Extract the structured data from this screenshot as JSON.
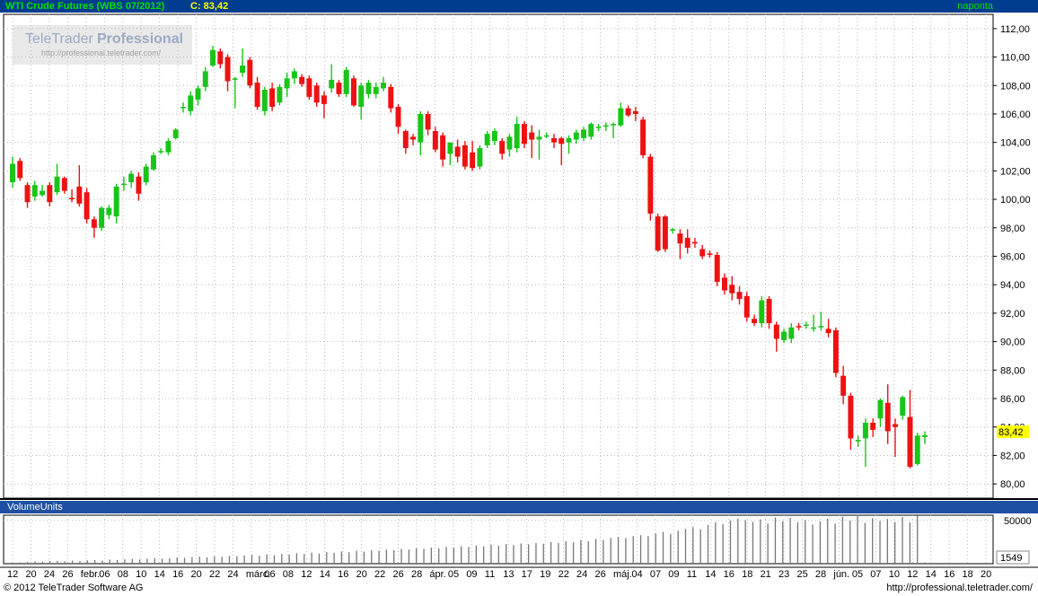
{
  "header": {
    "title": "WTI Crude Futures (WBS 07/2012)",
    "last": "C: 83,42",
    "interval": "naponta"
  },
  "volume_panel": {
    "title": "VolumeUnits",
    "last": "1549"
  },
  "watermark": {
    "brand": "TeleTrader",
    "product": "Professional",
    "url": "http://professional.teletrader.com/"
  },
  "footer": {
    "copyright": "© 2012 TeleTrader Software AG",
    "url": "http://professional.teletrader.com/"
  },
  "colors": {
    "up": "#19c419",
    "down": "#ee1111",
    "grid": "#b8b8b8",
    "header_bg": "#003d8f",
    "last_badge": "#ffff00"
  },
  "chart_data": [
    {
      "type": "candlestick",
      "title": "WTI Crude Futures (WBS 07/2012)",
      "last_price_label": "83,42",
      "ylim": [
        79,
        113
      ],
      "yticks": [
        "80,00",
        "82,00",
        "84,00",
        "86,00",
        "88,00",
        "90,00",
        "92,00",
        "94,00",
        "96,00",
        "98,00",
        "100,00",
        "102,00",
        "104,00",
        "106,00",
        "108,00",
        "110,00",
        "112,00"
      ],
      "xtick_labels": [
        "12",
        "20",
        "24",
        "26",
        "febr.",
        "06",
        "08",
        "10",
        "14",
        "16",
        "20",
        "22",
        "24",
        "márc.",
        "06",
        "08",
        "12",
        "14",
        "16",
        "20",
        "22",
        "26",
        "28",
        "ápr.",
        "05",
        "09",
        "11",
        "13",
        "17",
        "19",
        "22",
        "24",
        "26",
        "máj.",
        "04",
        "07",
        "09",
        "11",
        "14",
        "16",
        "18",
        "21",
        "23",
        "25",
        "28",
        "jún.",
        "05",
        "07",
        "10",
        "12",
        "14",
        "16",
        "18",
        "20"
      ],
      "candles": [
        {
          "o": 101.2,
          "h": 103.0,
          "l": 100.8,
          "c": 102.5
        },
        {
          "o": 102.7,
          "h": 102.9,
          "l": 101.3,
          "c": 101.5
        },
        {
          "o": 101.0,
          "h": 101.2,
          "l": 99.4,
          "c": 99.8
        },
        {
          "o": 100.2,
          "h": 101.3,
          "l": 99.9,
          "c": 101.0
        },
        {
          "o": 100.3,
          "h": 101.0,
          "l": 100.2,
          "c": 100.6
        },
        {
          "o": 101.0,
          "h": 101.2,
          "l": 99.5,
          "c": 99.8
        },
        {
          "o": 100.5,
          "h": 102.5,
          "l": 100.3,
          "c": 101.6
        },
        {
          "o": 101.5,
          "h": 101.6,
          "l": 100.4,
          "c": 100.6
        },
        {
          "o": 100.1,
          "h": 100.7,
          "l": 99.8,
          "c": 100.0
        },
        {
          "o": 100.9,
          "h": 102.4,
          "l": 99.5,
          "c": 99.7
        },
        {
          "o": 100.5,
          "h": 100.8,
          "l": 98.3,
          "c": 98.6
        },
        {
          "o": 98.6,
          "h": 98.8,
          "l": 97.3,
          "c": 98.0
        },
        {
          "o": 98.0,
          "h": 99.5,
          "l": 97.8,
          "c": 99.4
        },
        {
          "o": 98.9,
          "h": 99.6,
          "l": 98.6,
          "c": 99.4
        },
        {
          "o": 98.8,
          "h": 101.1,
          "l": 98.3,
          "c": 100.9
        },
        {
          "o": 101.0,
          "h": 101.6,
          "l": 100.6,
          "c": 101.1
        },
        {
          "o": 101.2,
          "h": 102.0,
          "l": 100.8,
          "c": 101.8
        },
        {
          "o": 101.6,
          "h": 101.9,
          "l": 99.9,
          "c": 100.4
        },
        {
          "o": 101.2,
          "h": 102.5,
          "l": 101.0,
          "c": 102.3
        },
        {
          "o": 102.1,
          "h": 103.3,
          "l": 102.0,
          "c": 103.1
        },
        {
          "o": 103.4,
          "h": 103.6,
          "l": 103.2,
          "c": 103.4
        },
        {
          "o": 103.3,
          "h": 104.3,
          "l": 103.1,
          "c": 104.1
        },
        {
          "o": 104.3,
          "h": 105.0,
          "l": 104.2,
          "c": 104.9
        },
        {
          "o": 106.5,
          "h": 106.8,
          "l": 106.1,
          "c": 106.5
        },
        {
          "o": 106.2,
          "h": 107.6,
          "l": 105.9,
          "c": 107.3
        },
        {
          "o": 107.0,
          "h": 108.0,
          "l": 106.6,
          "c": 107.8
        },
        {
          "o": 107.9,
          "h": 109.3,
          "l": 107.6,
          "c": 109.0
        },
        {
          "o": 109.4,
          "h": 110.8,
          "l": 109.3,
          "c": 110.5
        },
        {
          "o": 110.4,
          "h": 110.6,
          "l": 109.2,
          "c": 109.5
        },
        {
          "o": 110.0,
          "h": 110.2,
          "l": 107.6,
          "c": 108.3
        },
        {
          "o": 108.5,
          "h": 108.6,
          "l": 106.4,
          "c": 108.5
        },
        {
          "o": 108.9,
          "h": 110.6,
          "l": 108.6,
          "c": 109.4
        },
        {
          "o": 109.8,
          "h": 110.0,
          "l": 107.8,
          "c": 108.0
        },
        {
          "o": 108.2,
          "h": 108.6,
          "l": 106.3,
          "c": 106.5
        },
        {
          "o": 106.2,
          "h": 107.9,
          "l": 105.9,
          "c": 107.7
        },
        {
          "o": 107.8,
          "h": 108.2,
          "l": 106.2,
          "c": 106.5
        },
        {
          "o": 106.8,
          "h": 108.1,
          "l": 106.6,
          "c": 107.9
        },
        {
          "o": 107.8,
          "h": 108.9,
          "l": 107.2,
          "c": 108.5
        },
        {
          "o": 108.5,
          "h": 109.2,
          "l": 108.1,
          "c": 109.0
        },
        {
          "o": 108.6,
          "h": 108.8,
          "l": 107.9,
          "c": 108.1
        },
        {
          "o": 108.5,
          "h": 108.7,
          "l": 107.0,
          "c": 107.2
        },
        {
          "o": 108.0,
          "h": 108.2,
          "l": 106.5,
          "c": 106.8
        },
        {
          "o": 107.3,
          "h": 107.6,
          "l": 105.7,
          "c": 106.7
        },
        {
          "o": 107.8,
          "h": 109.5,
          "l": 107.5,
          "c": 108.4
        },
        {
          "o": 108.2,
          "h": 108.4,
          "l": 107.2,
          "c": 107.4
        },
        {
          "o": 107.4,
          "h": 109.3,
          "l": 107.2,
          "c": 109.1
        },
        {
          "o": 108.5,
          "h": 108.7,
          "l": 106.5,
          "c": 106.6
        },
        {
          "o": 106.5,
          "h": 108.2,
          "l": 105.6,
          "c": 108.0
        },
        {
          "o": 107.4,
          "h": 108.4,
          "l": 107.1,
          "c": 108.2
        },
        {
          "o": 107.4,
          "h": 108.2,
          "l": 107.1,
          "c": 107.9
        },
        {
          "o": 107.8,
          "h": 108.6,
          "l": 107.6,
          "c": 108.2
        },
        {
          "o": 107.9,
          "h": 108.1,
          "l": 106.1,
          "c": 106.4
        },
        {
          "o": 106.5,
          "h": 106.7,
          "l": 104.6,
          "c": 105.1
        },
        {
          "o": 104.8,
          "h": 104.9,
          "l": 103.2,
          "c": 103.6
        },
        {
          "o": 104.4,
          "h": 104.6,
          "l": 103.8,
          "c": 104.2
        },
        {
          "o": 104.0,
          "h": 106.2,
          "l": 103.1,
          "c": 106.0
        },
        {
          "o": 106.0,
          "h": 106.2,
          "l": 104.5,
          "c": 104.9
        },
        {
          "o": 104.8,
          "h": 105.1,
          "l": 103.3,
          "c": 103.5
        },
        {
          "o": 104.5,
          "h": 104.7,
          "l": 102.3,
          "c": 102.8
        },
        {
          "o": 103.2,
          "h": 103.7,
          "l": 102.4,
          "c": 104.0
        },
        {
          "o": 103.7,
          "h": 104.2,
          "l": 102.6,
          "c": 103.0
        },
        {
          "o": 103.8,
          "h": 104.1,
          "l": 102.1,
          "c": 102.3
        },
        {
          "o": 103.3,
          "h": 104.1,
          "l": 102.0,
          "c": 102.2
        },
        {
          "o": 102.3,
          "h": 103.8,
          "l": 102.1,
          "c": 103.6
        },
        {
          "o": 103.8,
          "h": 104.8,
          "l": 103.6,
          "c": 104.6
        },
        {
          "o": 104.1,
          "h": 105.0,
          "l": 103.8,
          "c": 104.8
        },
        {
          "o": 104.1,
          "h": 104.3,
          "l": 102.8,
          "c": 103.2
        },
        {
          "o": 103.5,
          "h": 104.6,
          "l": 103.0,
          "c": 104.4
        },
        {
          "o": 103.6,
          "h": 105.8,
          "l": 103.3,
          "c": 105.3
        },
        {
          "o": 105.3,
          "h": 105.5,
          "l": 103.6,
          "c": 103.9
        },
        {
          "o": 104.7,
          "h": 105.2,
          "l": 102.9,
          "c": 104.2
        },
        {
          "o": 104.2,
          "h": 104.9,
          "l": 102.8,
          "c": 104.4
        },
        {
          "o": 104.5,
          "h": 104.7,
          "l": 104.3,
          "c": 104.5
        },
        {
          "o": 104.3,
          "h": 104.6,
          "l": 103.6,
          "c": 104.0
        },
        {
          "o": 104.3,
          "h": 104.4,
          "l": 102.4,
          "c": 103.9
        },
        {
          "o": 104.0,
          "h": 104.5,
          "l": 103.2,
          "c": 104.3
        },
        {
          "o": 104.2,
          "h": 104.9,
          "l": 103.9,
          "c": 104.7
        },
        {
          "o": 104.3,
          "h": 105.1,
          "l": 104.1,
          "c": 104.9
        },
        {
          "o": 104.4,
          "h": 105.4,
          "l": 104.2,
          "c": 105.3
        },
        {
          "o": 105.1,
          "h": 105.3,
          "l": 104.8,
          "c": 105.1
        },
        {
          "o": 105.2,
          "h": 105.4,
          "l": 104.8,
          "c": 105.2
        },
        {
          "o": 105.2,
          "h": 105.4,
          "l": 104.3,
          "c": 105.3
        },
        {
          "o": 105.2,
          "h": 106.8,
          "l": 105.1,
          "c": 106.4
        },
        {
          "o": 106.4,
          "h": 106.6,
          "l": 105.8,
          "c": 105.9
        },
        {
          "o": 106.2,
          "h": 106.5,
          "l": 105.5,
          "c": 106.0
        },
        {
          "o": 105.6,
          "h": 105.8,
          "l": 102.9,
          "c": 103.1
        },
        {
          "o": 103.0,
          "h": 103.2,
          "l": 98.5,
          "c": 99.0
        },
        {
          "o": 98.8,
          "h": 99.0,
          "l": 96.3,
          "c": 96.4
        },
        {
          "o": 98.8,
          "h": 98.9,
          "l": 96.3,
          "c": 96.5
        },
        {
          "o": 97.8,
          "h": 98.0,
          "l": 97.6,
          "c": 97.9
        },
        {
          "o": 97.6,
          "h": 97.9,
          "l": 95.8,
          "c": 96.9
        },
        {
          "o": 97.3,
          "h": 97.9,
          "l": 96.2,
          "c": 96.6
        },
        {
          "o": 97.0,
          "h": 97.3,
          "l": 96.6,
          "c": 96.9
        },
        {
          "o": 96.5,
          "h": 96.8,
          "l": 95.8,
          "c": 96.0
        },
        {
          "o": 96.2,
          "h": 96.4,
          "l": 95.9,
          "c": 96.1
        },
        {
          "o": 96.1,
          "h": 96.3,
          "l": 93.9,
          "c": 94.2
        },
        {
          "o": 94.5,
          "h": 94.8,
          "l": 93.3,
          "c": 93.6
        },
        {
          "o": 94.0,
          "h": 94.6,
          "l": 92.9,
          "c": 93.4
        },
        {
          "o": 93.5,
          "h": 93.9,
          "l": 92.6,
          "c": 93.0
        },
        {
          "o": 93.2,
          "h": 93.5,
          "l": 91.4,
          "c": 91.7
        },
        {
          "o": 91.6,
          "h": 91.9,
          "l": 91.1,
          "c": 91.3
        },
        {
          "o": 91.3,
          "h": 93.2,
          "l": 91.0,
          "c": 92.9
        },
        {
          "o": 93.0,
          "h": 93.2,
          "l": 90.9,
          "c": 91.3
        },
        {
          "o": 91.2,
          "h": 91.4,
          "l": 89.3,
          "c": 90.2
        },
        {
          "o": 90.1,
          "h": 90.9,
          "l": 89.9,
          "c": 90.7
        },
        {
          "o": 90.2,
          "h": 91.3,
          "l": 89.9,
          "c": 91.0
        },
        {
          "o": 91.1,
          "h": 91.3,
          "l": 90.8,
          "c": 91.0
        },
        {
          "o": 91.2,
          "h": 91.4,
          "l": 90.9,
          "c": 91.2
        },
        {
          "o": 91.0,
          "h": 91.9,
          "l": 90.7,
          "c": 91.0
        },
        {
          "o": 91.0,
          "h": 92.1,
          "l": 90.8,
          "c": 91.1
        },
        {
          "o": 90.9,
          "h": 91.6,
          "l": 90.3,
          "c": 90.6
        },
        {
          "o": 90.8,
          "h": 91.0,
          "l": 87.5,
          "c": 87.8
        },
        {
          "o": 87.6,
          "h": 88.3,
          "l": 85.6,
          "c": 86.2
        },
        {
          "o": 86.2,
          "h": 86.4,
          "l": 82.4,
          "c": 83.2
        },
        {
          "o": 83.0,
          "h": 83.4,
          "l": 82.6,
          "c": 83.1
        },
        {
          "o": 83.2,
          "h": 84.6,
          "l": 81.2,
          "c": 84.3
        },
        {
          "o": 84.3,
          "h": 84.6,
          "l": 83.3,
          "c": 83.8
        },
        {
          "o": 84.6,
          "h": 86.0,
          "l": 84.0,
          "c": 85.9
        },
        {
          "o": 85.7,
          "h": 87.0,
          "l": 82.8,
          "c": 83.7
        },
        {
          "o": 84.2,
          "h": 84.6,
          "l": 81.9,
          "c": 84.0
        },
        {
          "o": 84.8,
          "h": 86.2,
          "l": 84.5,
          "c": 86.1
        },
        {
          "o": 84.7,
          "h": 86.6,
          "l": 81.1,
          "c": 81.2
        },
        {
          "o": 81.4,
          "h": 83.6,
          "l": 81.3,
          "c": 83.4
        },
        {
          "o": 83.3,
          "h": 83.7,
          "l": 82.8,
          "c": 83.42
        }
      ]
    },
    {
      "type": "bar",
      "title": "VolumeUnits",
      "last_value_label": "1549",
      "ylim": [
        0,
        56000
      ],
      "yticks": [
        "50000"
      ],
      "values": [
        1200,
        1600,
        2100,
        2600,
        2400,
        2900,
        3300,
        2800,
        3600,
        3000,
        3900,
        4200,
        3500,
        4700,
        4300,
        5000,
        5600,
        4900,
        5900,
        6500,
        5800,
        6400,
        7100,
        6800,
        7600,
        8100,
        7300,
        8700,
        7900,
        9100,
        8600,
        9400,
        10200,
        9300,
        10800,
        9800,
        11400,
        10600,
        12100,
        11200,
        12800,
        11700,
        13400,
        12600,
        14100,
        13300,
        14900,
        14000,
        15700,
        14800,
        16200,
        15600,
        17100,
        16300,
        17900,
        17200,
        18600,
        17800,
        19400,
        18500,
        20200,
        19300,
        21100,
        20000,
        21900,
        20800,
        22700,
        21500,
        23300,
        22400,
        24100,
        23100,
        25000,
        24000,
        26000,
        24600,
        27200,
        26100,
        28500,
        27300,
        29800,
        30900,
        29600,
        31800,
        33000,
        31900,
        35000,
        36800,
        34500,
        38200,
        40100,
        42300,
        39700,
        44900,
        47800,
        45600,
        49900,
        52100,
        50300,
        48400,
        51200,
        46700,
        53400,
        49100,
        52800,
        47900,
        50600,
        45200,
        48700,
        51900,
        46300,
        54200,
        49800,
        56800,
        47200,
        52600,
        49300,
        51700,
        48100,
        53900,
        47600,
        55300,
        1549
      ]
    }
  ]
}
